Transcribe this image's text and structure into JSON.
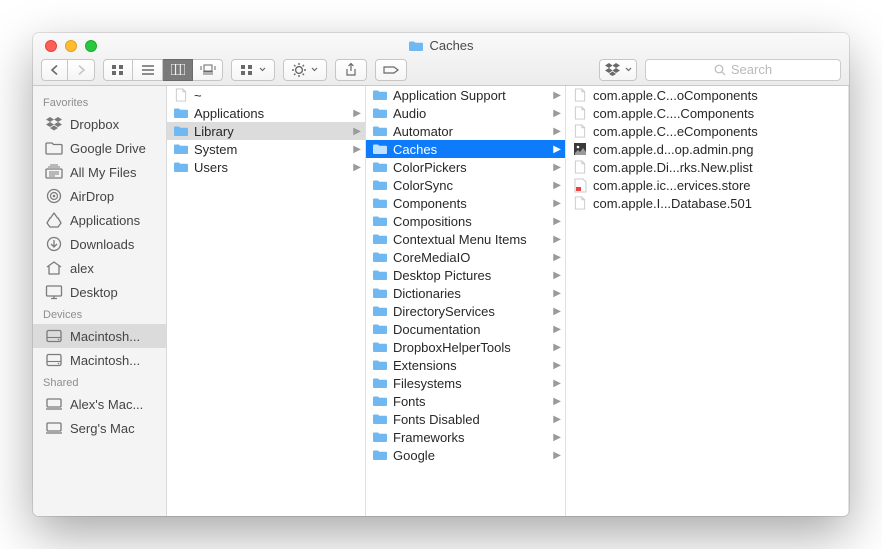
{
  "title": "Caches",
  "search_placeholder": "Search",
  "sidebar": {
    "sections": [
      {
        "label": "Favorites",
        "items": [
          {
            "icon": "dropbox",
            "label": "Dropbox"
          },
          {
            "icon": "folder",
            "label": "Google Drive"
          },
          {
            "icon": "allfiles",
            "label": "All My Files"
          },
          {
            "icon": "airdrop",
            "label": "AirDrop"
          },
          {
            "icon": "apps",
            "label": "Applications"
          },
          {
            "icon": "downloads",
            "label": "Downloads"
          },
          {
            "icon": "home",
            "label": "alex"
          },
          {
            "icon": "desktop",
            "label": "Desktop"
          }
        ]
      },
      {
        "label": "Devices",
        "items": [
          {
            "icon": "disk",
            "label": "Macintosh...",
            "selected": true
          },
          {
            "icon": "disk",
            "label": "Macintosh..."
          }
        ]
      },
      {
        "label": "Shared",
        "items": [
          {
            "icon": "machine",
            "label": "Alex's Mac..."
          },
          {
            "icon": "machine",
            "label": "Serg's Mac"
          }
        ]
      }
    ]
  },
  "columns": [
    {
      "items": [
        {
          "icon": "file",
          "label": "~",
          "arrow": false
        },
        {
          "icon": "folder",
          "label": "Applications",
          "arrow": true
        },
        {
          "icon": "folder",
          "label": "Library",
          "arrow": true,
          "selected": true
        },
        {
          "icon": "folder",
          "label": "System",
          "arrow": true
        },
        {
          "icon": "folder",
          "label": "Users",
          "arrow": true
        }
      ]
    },
    {
      "items": [
        {
          "icon": "folder",
          "label": "Application Support",
          "arrow": true
        },
        {
          "icon": "folder",
          "label": "Audio",
          "arrow": true
        },
        {
          "icon": "folder",
          "label": "Automator",
          "arrow": true
        },
        {
          "icon": "folder",
          "label": "Caches",
          "arrow": true,
          "selected": true,
          "focus": true
        },
        {
          "icon": "folder",
          "label": "ColorPickers",
          "arrow": true
        },
        {
          "icon": "folder",
          "label": "ColorSync",
          "arrow": true
        },
        {
          "icon": "folder",
          "label": "Components",
          "arrow": true
        },
        {
          "icon": "folder",
          "label": "Compositions",
          "arrow": true
        },
        {
          "icon": "folder",
          "label": "Contextual Menu Items",
          "arrow": true
        },
        {
          "icon": "folder",
          "label": "CoreMediaIO",
          "arrow": true
        },
        {
          "icon": "folder",
          "label": "Desktop Pictures",
          "arrow": true
        },
        {
          "icon": "folder",
          "label": "Dictionaries",
          "arrow": true
        },
        {
          "icon": "folder",
          "label": "DirectoryServices",
          "arrow": true
        },
        {
          "icon": "folder",
          "label": "Documentation",
          "arrow": true
        },
        {
          "icon": "folder",
          "label": "DropboxHelperTools",
          "arrow": true
        },
        {
          "icon": "folder",
          "label": "Extensions",
          "arrow": true
        },
        {
          "icon": "folder",
          "label": "Filesystems",
          "arrow": true
        },
        {
          "icon": "folder",
          "label": "Fonts",
          "arrow": true
        },
        {
          "icon": "folder",
          "label": "Fonts Disabled",
          "arrow": true
        },
        {
          "icon": "folder",
          "label": "Frameworks",
          "arrow": true
        },
        {
          "icon": "folder",
          "label": "Google",
          "arrow": true
        }
      ]
    },
    {
      "items": [
        {
          "icon": "file",
          "label": "com.apple.C...oComponents",
          "arrow": false
        },
        {
          "icon": "file",
          "label": "com.apple.C....Components",
          "arrow": false
        },
        {
          "icon": "file",
          "label": "com.apple.C...eComponents",
          "arrow": false
        },
        {
          "icon": "png",
          "label": "com.apple.d...op.admin.png",
          "arrow": false
        },
        {
          "icon": "file",
          "label": "com.apple.Di...rks.New.plist",
          "arrow": false
        },
        {
          "icon": "store",
          "label": "com.apple.ic...ervices.store",
          "arrow": false
        },
        {
          "icon": "file",
          "label": "com.apple.I...Database.501",
          "arrow": false
        }
      ]
    }
  ]
}
